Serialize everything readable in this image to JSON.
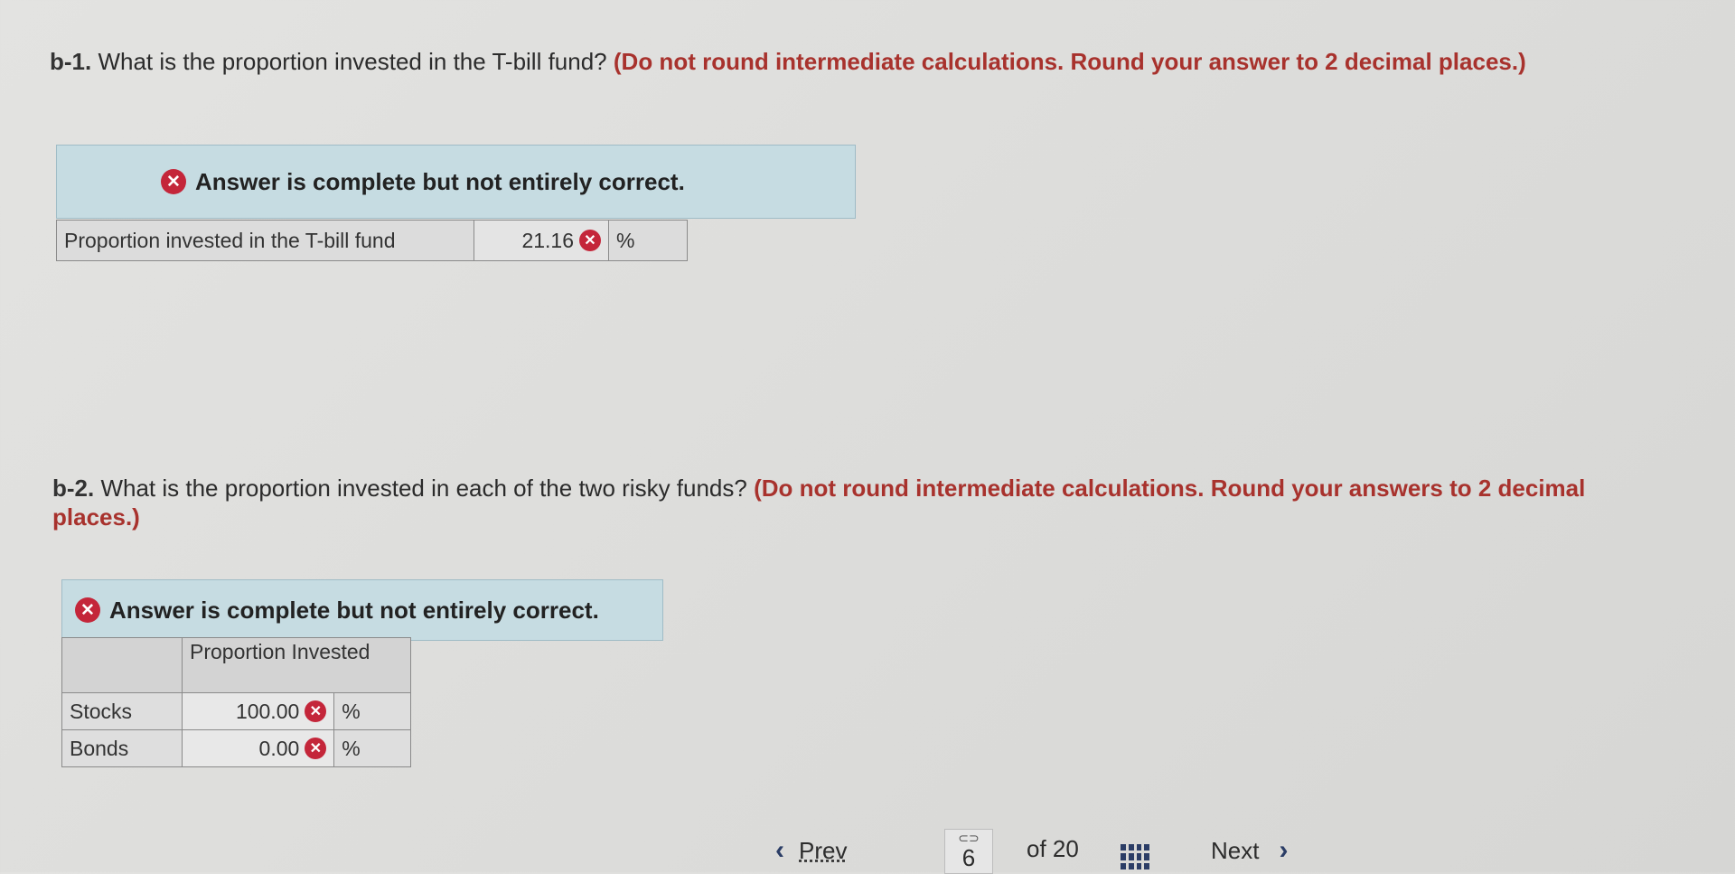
{
  "b1": {
    "number": "b-1.",
    "question": "What is the proportion invested in the T-bill fund?",
    "instruction": "(Do not round intermediate calculations. Round your answer to 2 decimal places.)",
    "banner": "Answer is complete but not entirely correct.",
    "row_label": "Proportion invested in the T-bill fund",
    "value": "21.16",
    "unit": "%"
  },
  "b2": {
    "number": "b-2.",
    "question": "What is the proportion invested in each of the two risky funds?",
    "instruction": "(Do not round intermediate calculations. Round your answers to 2 decimal places.)",
    "banner": "Answer is complete but not entirely correct.",
    "column_header": "Proportion Invested",
    "rows": [
      {
        "label": "Stocks",
        "value": "100.00",
        "unit": "%"
      },
      {
        "label": "Bonds",
        "value": "0.00",
        "unit": "%"
      }
    ]
  },
  "nav": {
    "prev_label": "Prev",
    "page": "6",
    "of_label": "of 20",
    "next_label": "Next"
  },
  "icons": {
    "incorrect": "x-circle-icon",
    "link": "link-icon",
    "grid": "grid-icon"
  },
  "colors": {
    "incorrect": "#c4263a",
    "instruction": "#a8322d",
    "banner": "#c6dce2"
  }
}
